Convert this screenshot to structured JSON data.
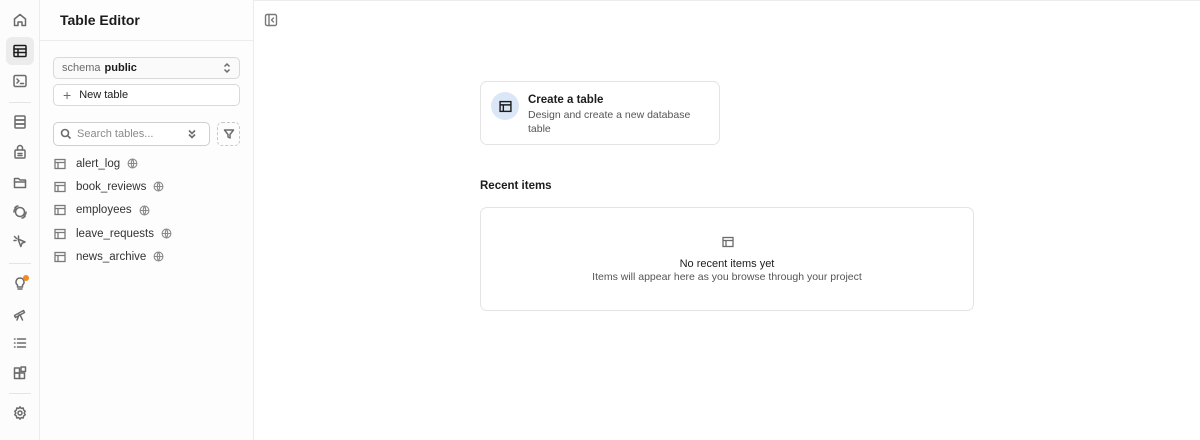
{
  "rail": {
    "icons": [
      "home-icon",
      "table-editor-icon",
      "sql-editor-icon",
      "database-icon",
      "auth-icon",
      "storage-icon",
      "realtime-icon",
      "edge-functions-icon",
      "advisors-icon",
      "reports-icon",
      "logs-icon",
      "integrations-icon",
      "settings-icon"
    ],
    "notification_color": "#f08a24"
  },
  "sidebar": {
    "title": "Table Editor",
    "schema": {
      "label": "schema",
      "value": "public"
    },
    "new_table_label": "New table",
    "search": {
      "placeholder": "Search tables...",
      "value": ""
    },
    "tables": [
      {
        "name": "alert_log"
      },
      {
        "name": "book_reviews"
      },
      {
        "name": "employees"
      },
      {
        "name": "leave_requests"
      },
      {
        "name": "news_archive"
      }
    ]
  },
  "main": {
    "create_card": {
      "title": "Create a table",
      "description": "Design and create a new database table",
      "accent_color": "#dbe7f7"
    },
    "recent": {
      "heading": "Recent items",
      "empty_title": "No recent items yet",
      "empty_description": "Items will appear here as you browse through your project"
    }
  }
}
